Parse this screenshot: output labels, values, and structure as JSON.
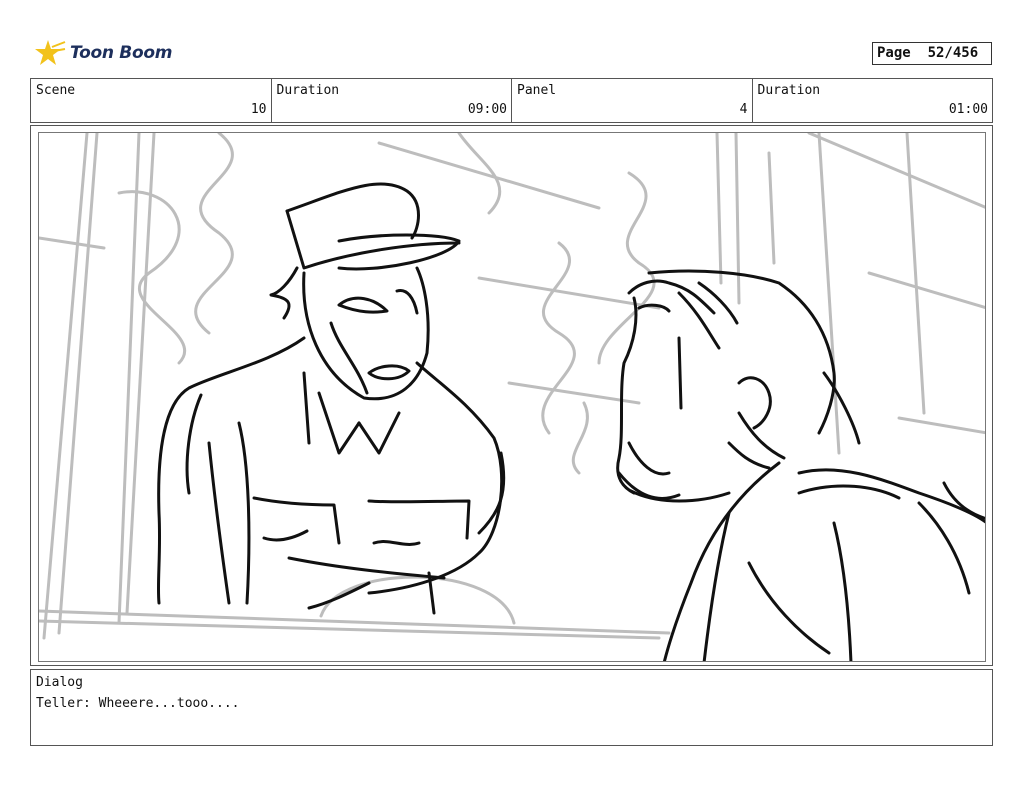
{
  "brand": {
    "name": "Toon Boom",
    "accent": "#f2c21b",
    "text_color": "#1d2f5c",
    "icon": "toon-boom-star-icon"
  },
  "page": {
    "label": "Page",
    "value": "52/456"
  },
  "header": {
    "scene_label": "Scene",
    "scene_value": "10",
    "duration_label": "Duration",
    "duration_value": "09:00",
    "panel_label": "Panel",
    "panel_value": "4",
    "panel_duration_label": "Duration",
    "panel_duration_value": "01:00"
  },
  "panel": {
    "description_icon": "storyboard-sketch"
  },
  "dialog": {
    "label": "Dialog",
    "text": "Teller: Wheeere...tooo...."
  }
}
